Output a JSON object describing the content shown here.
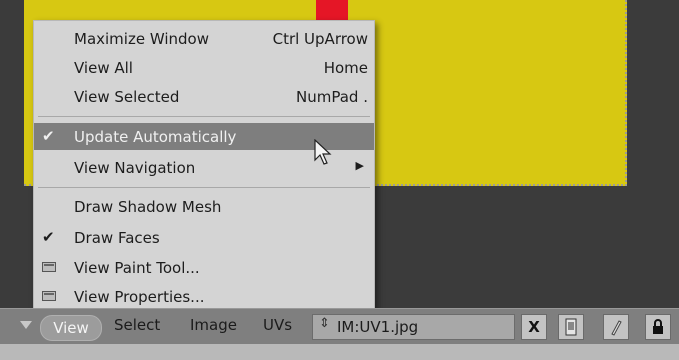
{
  "menu": {
    "items": [
      {
        "label": "Maximize Window",
        "shortcut": "Ctrl UpArrow"
      },
      {
        "label": "View All",
        "shortcut": "Home"
      },
      {
        "label": "View Selected",
        "shortcut": "NumPad ."
      },
      {
        "label": "Update Automatically",
        "checked": true,
        "highlighted": true
      },
      {
        "label": "View Navigation",
        "submenu": true
      },
      {
        "label": "Draw Shadow Mesh"
      },
      {
        "label": "Draw Faces",
        "checked": true
      },
      {
        "label": "View Paint Tool...",
        "icon": "window-icon"
      },
      {
        "label": "View Properties...",
        "icon": "window-icon"
      }
    ]
  },
  "header": {
    "menus": [
      "View",
      "Select",
      "Image",
      "UVs"
    ],
    "image_name": "IM:UV1.jpg",
    "close_label": "X"
  },
  "colors": {
    "image_yellow": "#d7c812",
    "marker_red": "#e51626",
    "menu_bg": "#d4d4d4",
    "highlight": "#7e7e7e",
    "header_bg": "#7f7f7f"
  }
}
